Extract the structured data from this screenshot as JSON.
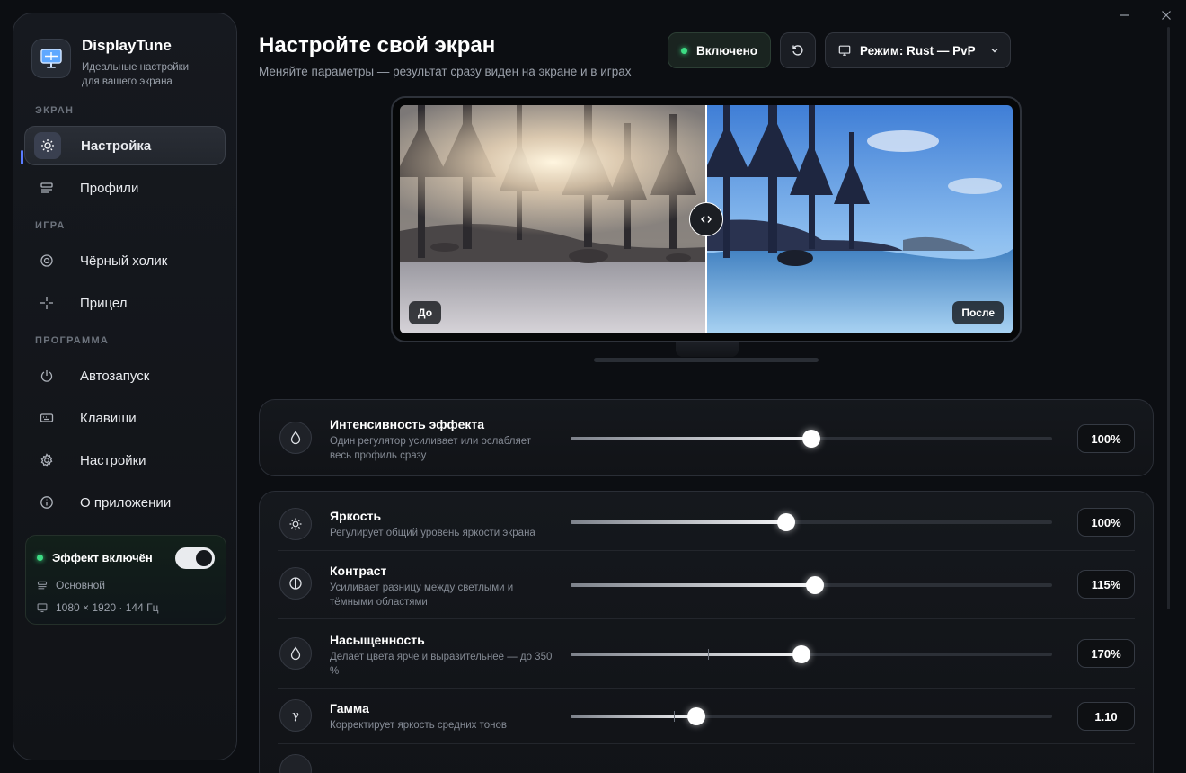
{
  "app": {
    "name": "DisplayTune",
    "subtitle": "Идеальные настройки для вашего экрана"
  },
  "sidebar": {
    "section_screen": "ЭКРАН",
    "section_game": "ИГРА",
    "section_program": "ПРОГРАММА",
    "items": [
      {
        "label": "Настройка",
        "icon": "sun-icon",
        "active": true
      },
      {
        "label": "Профили",
        "icon": "profiles-icon"
      },
      {
        "label": "Чёрный холик",
        "icon": "target-icon"
      },
      {
        "label": "Прицел",
        "icon": "crosshair-icon"
      },
      {
        "label": "Автозапуск",
        "icon": "power-icon"
      },
      {
        "label": "Клавиши",
        "icon": "keyboard-icon"
      },
      {
        "label": "Настройки",
        "icon": "gear-icon"
      },
      {
        "label": "О приложении",
        "icon": "info-icon"
      }
    ],
    "effect": {
      "title": "Эффект включён",
      "enabled": true,
      "profile": "Основной",
      "display": "1080 × 1920 · 144 Гц"
    }
  },
  "header": {
    "title": "Настройте свой экран",
    "subtitle": "Меняйте параметры — результат сразу виден на экране и в играх",
    "status": "Включено",
    "mode": "Режим: Rust — PvP"
  },
  "preview": {
    "before": "До",
    "after": "После",
    "split_fraction": 0.5
  },
  "intensity": {
    "title": "Интенсивность эффекта",
    "desc": "Один регулятор усиливает или ослабляет весь профиль сразу",
    "value": "100%",
    "level": 0.5
  },
  "settings": [
    {
      "title": "Яркость",
      "desc": "Регулирует общий уровень яркости экрана",
      "value": "100%",
      "level": 0.448,
      "icon": "sun-icon"
    },
    {
      "title": "Контраст",
      "desc": "Усиливает разницу между светлыми и тёмными областями",
      "value": "115%",
      "level": 0.5075,
      "default": 0.44,
      "icon": "contrast-icon"
    },
    {
      "title": "Насыщенность",
      "desc": "Делает цвета ярче и выразительнее — до 350 %",
      "value": "170%",
      "level": 0.4795,
      "default": 0.285,
      "icon": "drop-icon"
    },
    {
      "title": "Гамма",
      "desc": "Корректирует яркость средних тонов",
      "value": "1.10",
      "level": 0.2605,
      "default": 0.215,
      "icon": "gamma-icon"
    }
  ],
  "colors": {
    "accent": "#5a7cff",
    "status_green": "#3ddc84"
  }
}
